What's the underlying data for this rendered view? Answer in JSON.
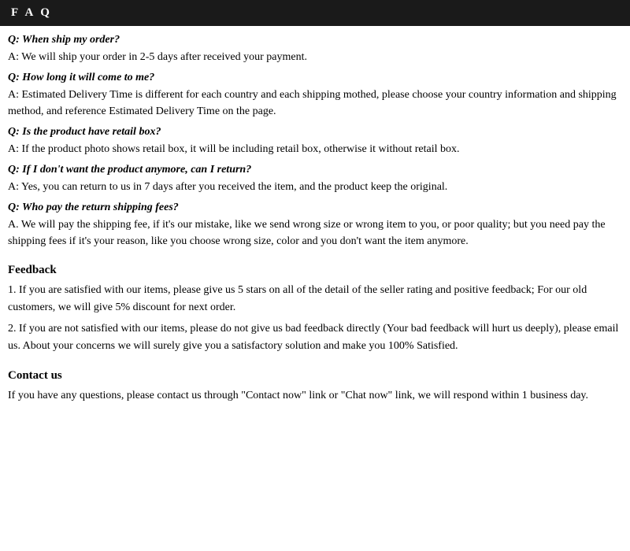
{
  "header": {
    "title": "F A Q"
  },
  "faq": {
    "items": [
      {
        "question": "Q: When ship my order?",
        "answer": "A: We will ship your order in 2-5 days after received your payment."
      },
      {
        "question": "Q: How long it will come to me?",
        "answer": "A: Estimated Delivery Time is different for each country and each shipping mothed, please choose your country information and shipping method, and reference Estimated Delivery Time on the page."
      },
      {
        "question": "Q: Is the product have retail box?",
        "answer": "A: If the product photo shows retail box, it will be including retail box, otherwise it without retail box."
      },
      {
        "question": "Q: If I don't want the product anymore, can I return?",
        "answer": "A: Yes, you can return to us in 7 days after you received the item, and the product keep the original."
      },
      {
        "question": "Q: Who pay the return shipping fees?",
        "answer": "A.  We will pay the shipping fee, if it's our mistake, like we send wrong size or wrong item to you, or poor quality; but you need pay the shipping fees if it's your reason, like you choose wrong size, color and you don't want the item anymore."
      }
    ]
  },
  "feedback": {
    "title": "Feedback",
    "items": [
      "1.  If you are satisfied with our items, please give us 5 stars on all of the detail of the seller rating and positive feedback; For our old customers, we will give 5% discount for next order.",
      "2.  If you are not satisfied with our items, please do not give us bad feedback directly (Your bad feedback will hurt us deeply), please email us. About your concerns we will surely give you a satisfactory solution and make you 100% Satisfied."
    ]
  },
  "contact": {
    "title": "Contact us",
    "text": "If you have any questions, please contact us through \"Contact now\" link or \"Chat now\" link, we will respond within 1 business day."
  }
}
